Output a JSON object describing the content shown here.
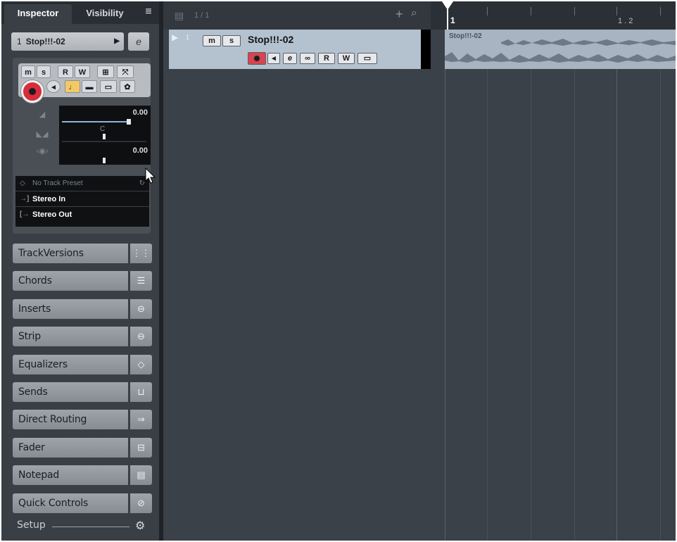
{
  "inspector": {
    "tabs": {
      "active": "Inspector",
      "inactive": "Visibility"
    },
    "menu_icon": "hamburger-icon",
    "track": {
      "number": "1",
      "name": "Stop!!!-02"
    },
    "buttons": {
      "mute": "m",
      "solo": "s",
      "read": "R",
      "write": "W",
      "lane": "⊞",
      "freeze": "⤧"
    },
    "volume": "0.00",
    "pan": "C",
    "delay": "0.00",
    "routing": {
      "preset": "No Track Preset",
      "input": "Stereo In",
      "output": "Stereo Out"
    },
    "sections": [
      {
        "label": "TrackVersions",
        "icon": "track-versions-icon",
        "glyph": "⋮⋮"
      },
      {
        "label": "Chords",
        "icon": "chords-icon",
        "glyph": "☰"
      },
      {
        "label": "Inserts",
        "icon": "inserts-icon",
        "glyph": "⊖"
      },
      {
        "label": "Strip",
        "icon": "strip-icon",
        "glyph": "⊖"
      },
      {
        "label": "Equalizers",
        "icon": "equalizer-icon",
        "glyph": "◇"
      },
      {
        "label": "Sends",
        "icon": "sends-icon",
        "glyph": "⊔"
      },
      {
        "label": "Direct Routing",
        "icon": "direct-routing-icon",
        "glyph": "⇒"
      },
      {
        "label": "Fader",
        "icon": "fader-icon",
        "glyph": "⊟"
      },
      {
        "label": "Notepad",
        "icon": "notepad-icon",
        "glyph": "▤"
      },
      {
        "label": "Quick Controls",
        "icon": "quick-controls-icon",
        "glyph": "⊘"
      }
    ],
    "setup_label": "Setup"
  },
  "tracklist": {
    "count": "1 / 1",
    "track": {
      "number": "1",
      "name": "Stop!!!-02",
      "mute": "m",
      "solo": "s",
      "read": "R",
      "write": "W"
    }
  },
  "arrange": {
    "ruler": {
      "bar1": "1",
      "bar1_2": "1 . 2"
    },
    "event": {
      "name": "Stop!!!-02"
    }
  },
  "colors": {
    "record": "#d82c3c",
    "track_selected": "#b4c1cf",
    "event": "#a8b4c2",
    "monitor_highlight": "#f3c968"
  }
}
